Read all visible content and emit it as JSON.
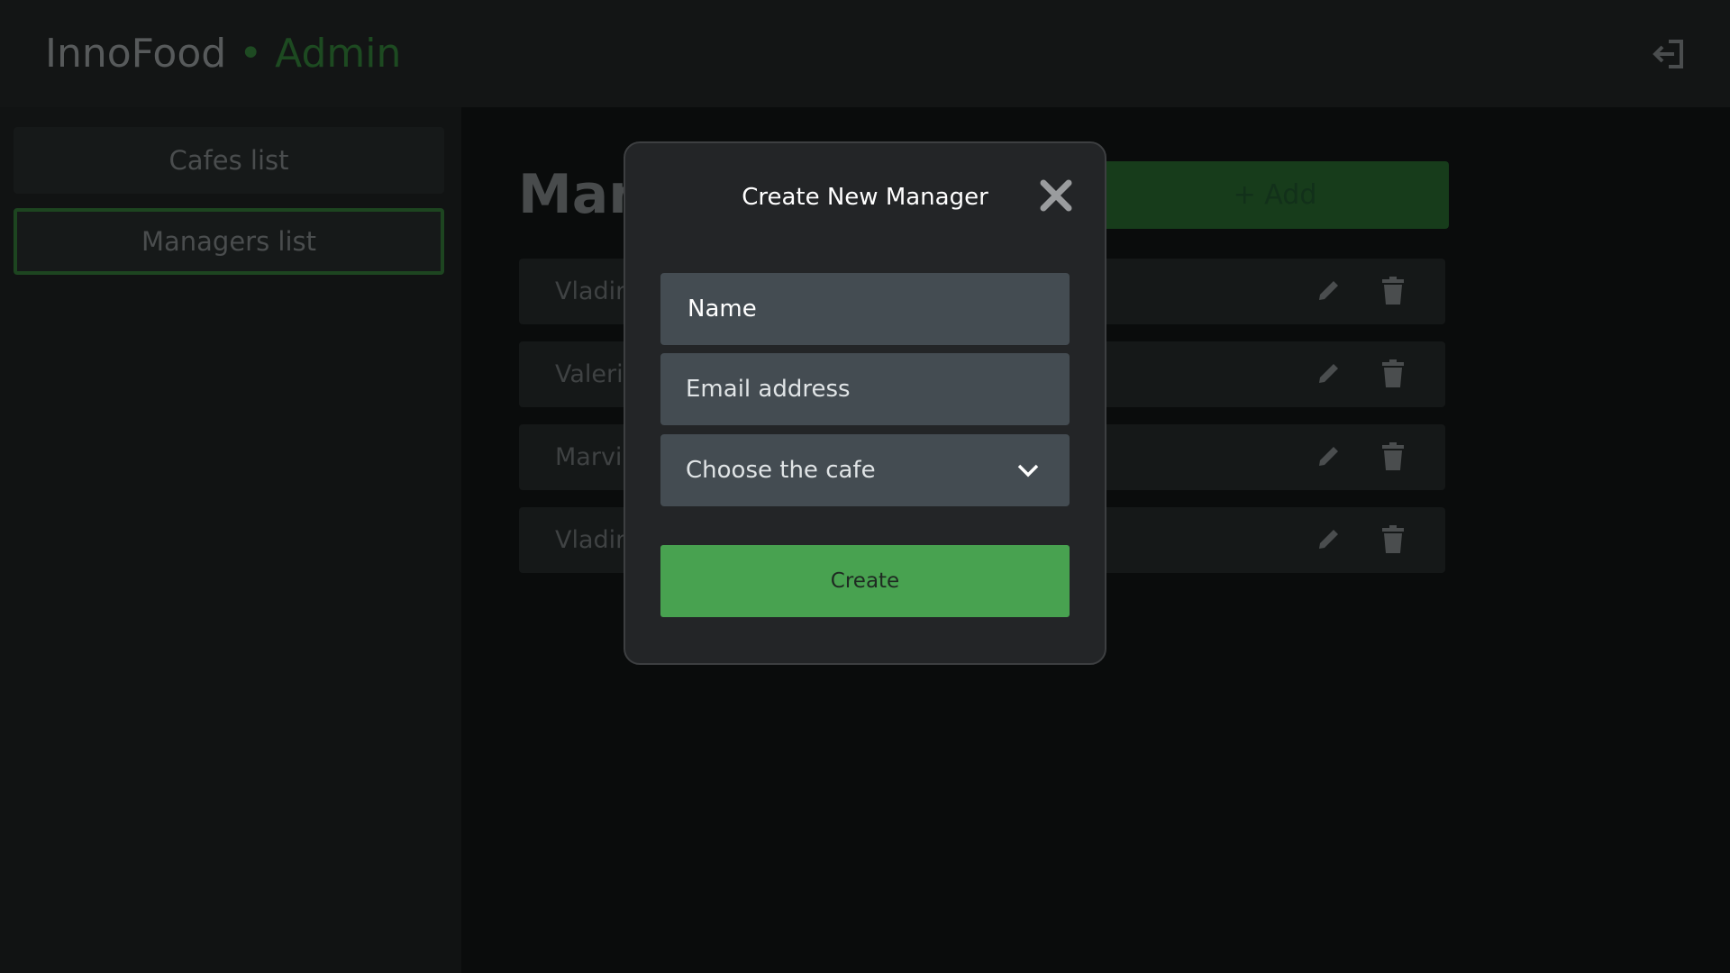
{
  "header": {
    "app_name": "InnoFood",
    "separator": "•",
    "role": "Admin",
    "logout_icon": "logout-icon"
  },
  "sidebar": {
    "items": [
      {
        "label": "Cafes list",
        "active": false
      },
      {
        "label": "Managers list",
        "active": true
      }
    ]
  },
  "main": {
    "title_visible": "Man",
    "add_label": "+ Add",
    "rows": [
      {
        "name_visible": "Vladin"
      },
      {
        "name_visible": "Valeria"
      },
      {
        "name_visible": "Marvir"
      },
      {
        "name_visible": "Vladin"
      }
    ],
    "row_icons": [
      "pencil-icon",
      "trash-icon"
    ]
  },
  "modal": {
    "title": "Create New Manager",
    "close_icon": "close-icon",
    "name_placeholder": "Name",
    "email_placeholder": "Email address",
    "cafe_select_label": "Choose the cafe",
    "create_label": "Create"
  },
  "colors": {
    "accent_green": "#48a250",
    "modal_bg": "#232527",
    "field_bg": "#444c52"
  }
}
